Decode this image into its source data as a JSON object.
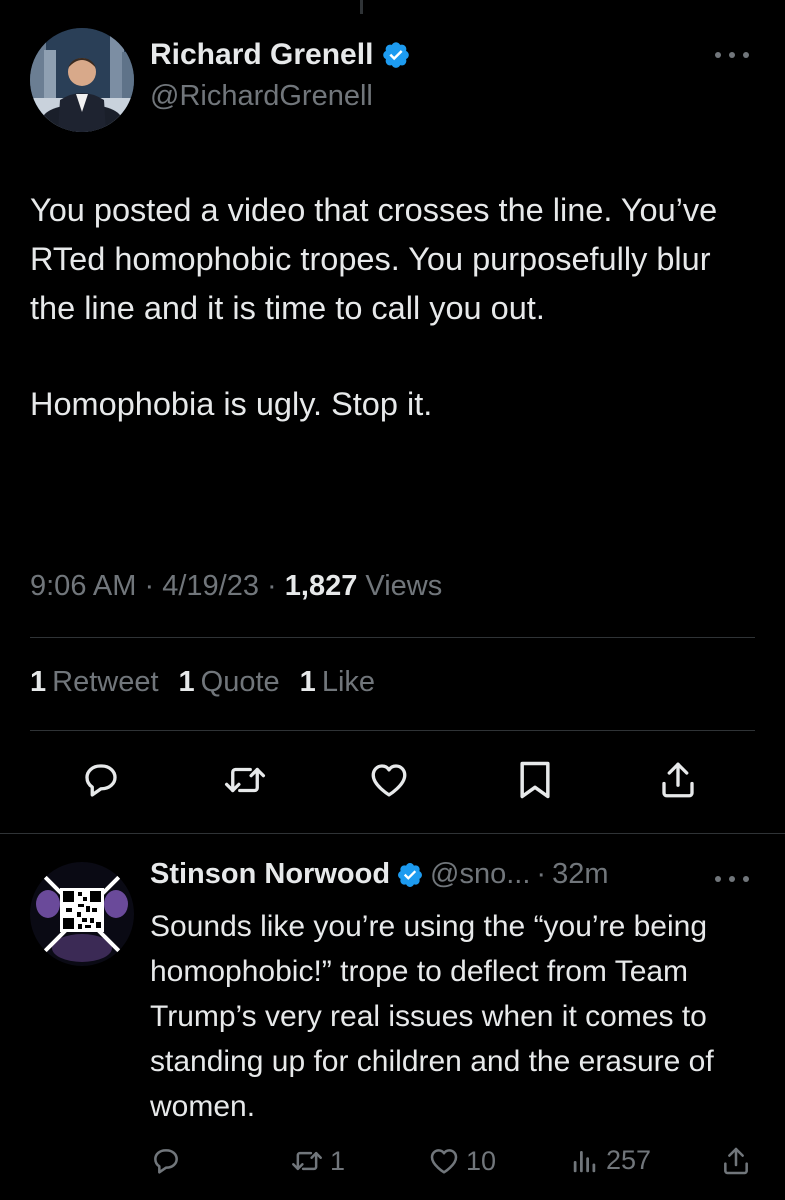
{
  "main_tweet": {
    "author_name": "Richard Grenell",
    "author_handle": "@RichardGrenell",
    "paragraph_1": "You posted a video that crosses the line. You’ve RTed homophobic tropes. You purposefully blur the line and it is time to call you out.",
    "paragraph_2": "Homophobia is ugly. Stop it.",
    "time": "9:06 AM",
    "date": "4/19/23",
    "views_count": "1,827",
    "views_label": "Views",
    "retweets_count": "1",
    "retweets_label": "Retweet",
    "quotes_count": "1",
    "quotes_label": "Quote",
    "likes_count": "1",
    "likes_label": "Like"
  },
  "reply": {
    "author_name": "Stinson Norwood",
    "handle_truncated": "@sno...",
    "time_ago": "32m",
    "text": "Sounds like you’re using the “you’re being homophobic!” trope to deflect from Team Trump’s very real issues when it comes to standing up for children and the erasure of women.",
    "retweets": "1",
    "likes": "10",
    "views": "257"
  },
  "separator": "·",
  "icons": {
    "verified": "verified-badge-icon",
    "more": "more-icon",
    "reply": "reply-icon",
    "retweet": "retweet-icon",
    "like": "heart-icon",
    "bookmark": "bookmark-icon",
    "share": "share-icon",
    "views": "views-icon"
  },
  "colors": {
    "background": "#000000",
    "text": "#e7e9ea",
    "muted": "#71767b",
    "verified": "#1d9bf0",
    "divider": "#2f3336"
  }
}
